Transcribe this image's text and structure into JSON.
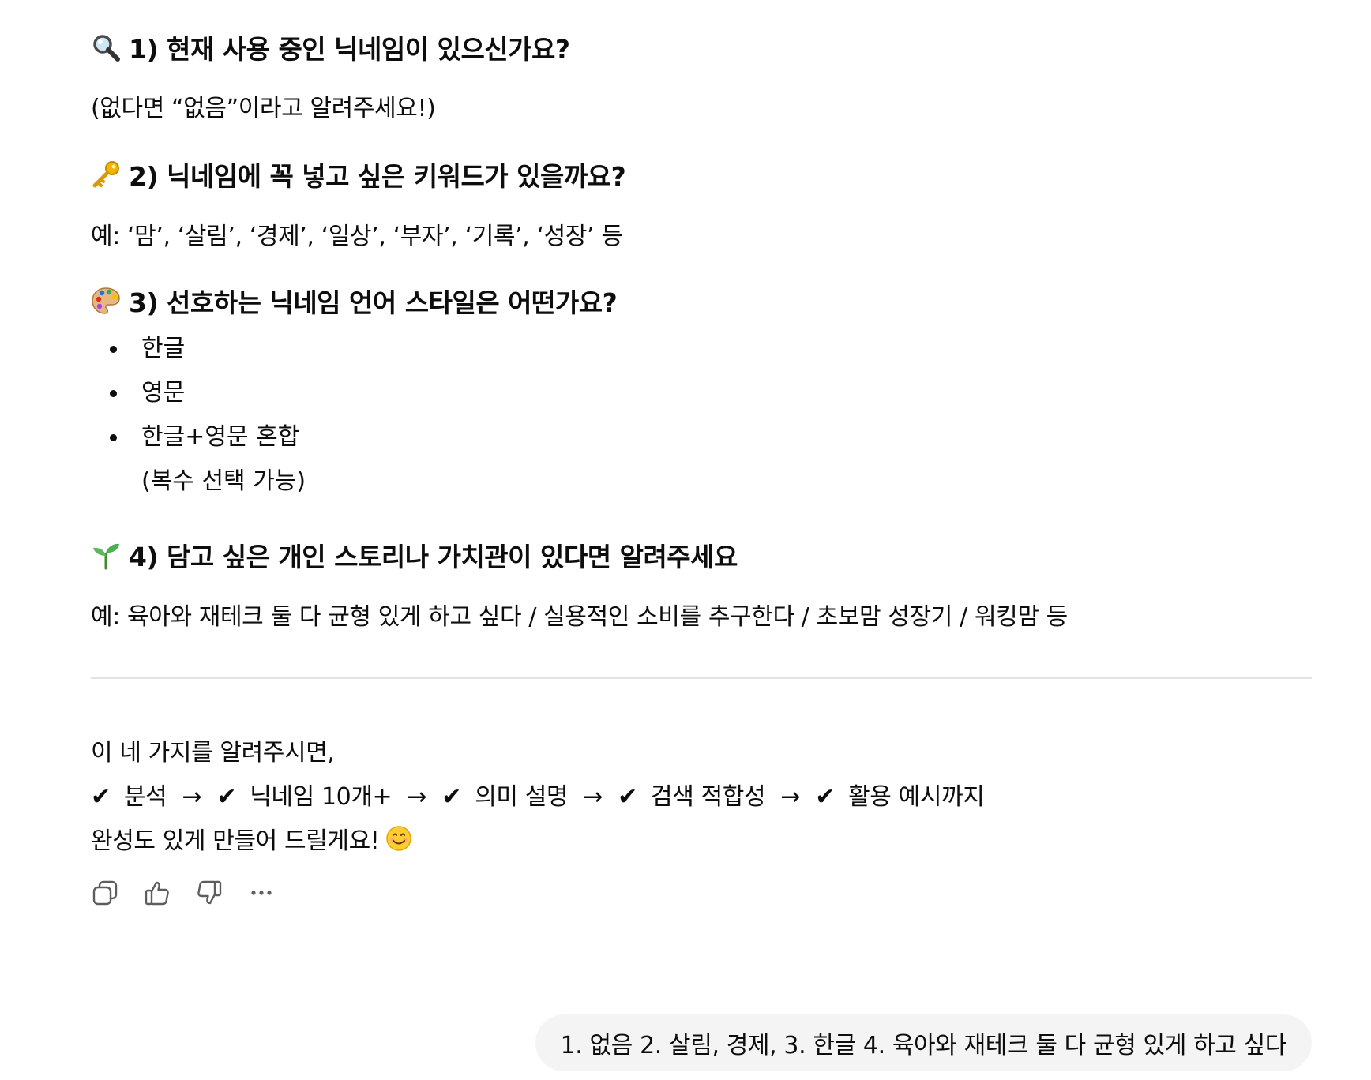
{
  "assistant_message": {
    "questions": [
      {
        "icon": "magnifier-icon",
        "heading": "1) 현재 사용 중인 닉네임이 있으신가요?",
        "detail": "(없다면 “없음”이라고 알려주세요!)"
      },
      {
        "icon": "key-icon",
        "heading": "2) 닉네임에 꼭 넣고 싶은 키워드가 있을까요?",
        "detail": "예: ‘맘’, ‘살림’, ‘경제’, ‘일상’, ‘부자’, ‘기록’, ‘성장’ 등"
      },
      {
        "icon": "palette-icon",
        "heading": "3) 선호하는 닉네임 언어 스타일은 어떤가요?",
        "options": [
          "한글",
          "영문",
          "한글+영문 혼합"
        ],
        "note": "(복수 선택 가능)"
      },
      {
        "icon": "seedling-icon",
        "heading": "4) 담고 싶은 개인 스토리나 가치관이 있다면 알려주세요",
        "detail": "예: 육아와 재테크 둘 다 균형 있게 하고 싶다 / 실용적인 소비를 추구한다 / 초보맘 성장기 / 워킹맘 등"
      }
    ],
    "closing": {
      "line1": "이 네 가지를 알려주시면,",
      "steps": [
        "분석",
        "닉네임 10개+",
        "의미 설명",
        "검색 적합성",
        "활용 예시까지"
      ],
      "arrow": "→",
      "check": "✔",
      "line3": "완성도 있게 만들어 드릴게요!",
      "line3_emoji": "smiling-face-icon"
    },
    "actions": [
      {
        "name": "copy-icon",
        "label": "Copy"
      },
      {
        "name": "thumbs-up-icon",
        "label": "Good response"
      },
      {
        "name": "thumbs-down-icon",
        "label": "Bad response"
      },
      {
        "name": "more-icon",
        "label": "More"
      }
    ]
  },
  "user_message": {
    "text": "1. 없음 2. 살림, 경제, 3. 한글 4. 육아와 재테크 둘 다 균형 있게 하고 싶다"
  },
  "colors": {
    "text": "#0d0d0d",
    "bubble_bg": "#f4f4f4",
    "divider": "#e3e3e3",
    "icon": "#5d5d5d"
  }
}
